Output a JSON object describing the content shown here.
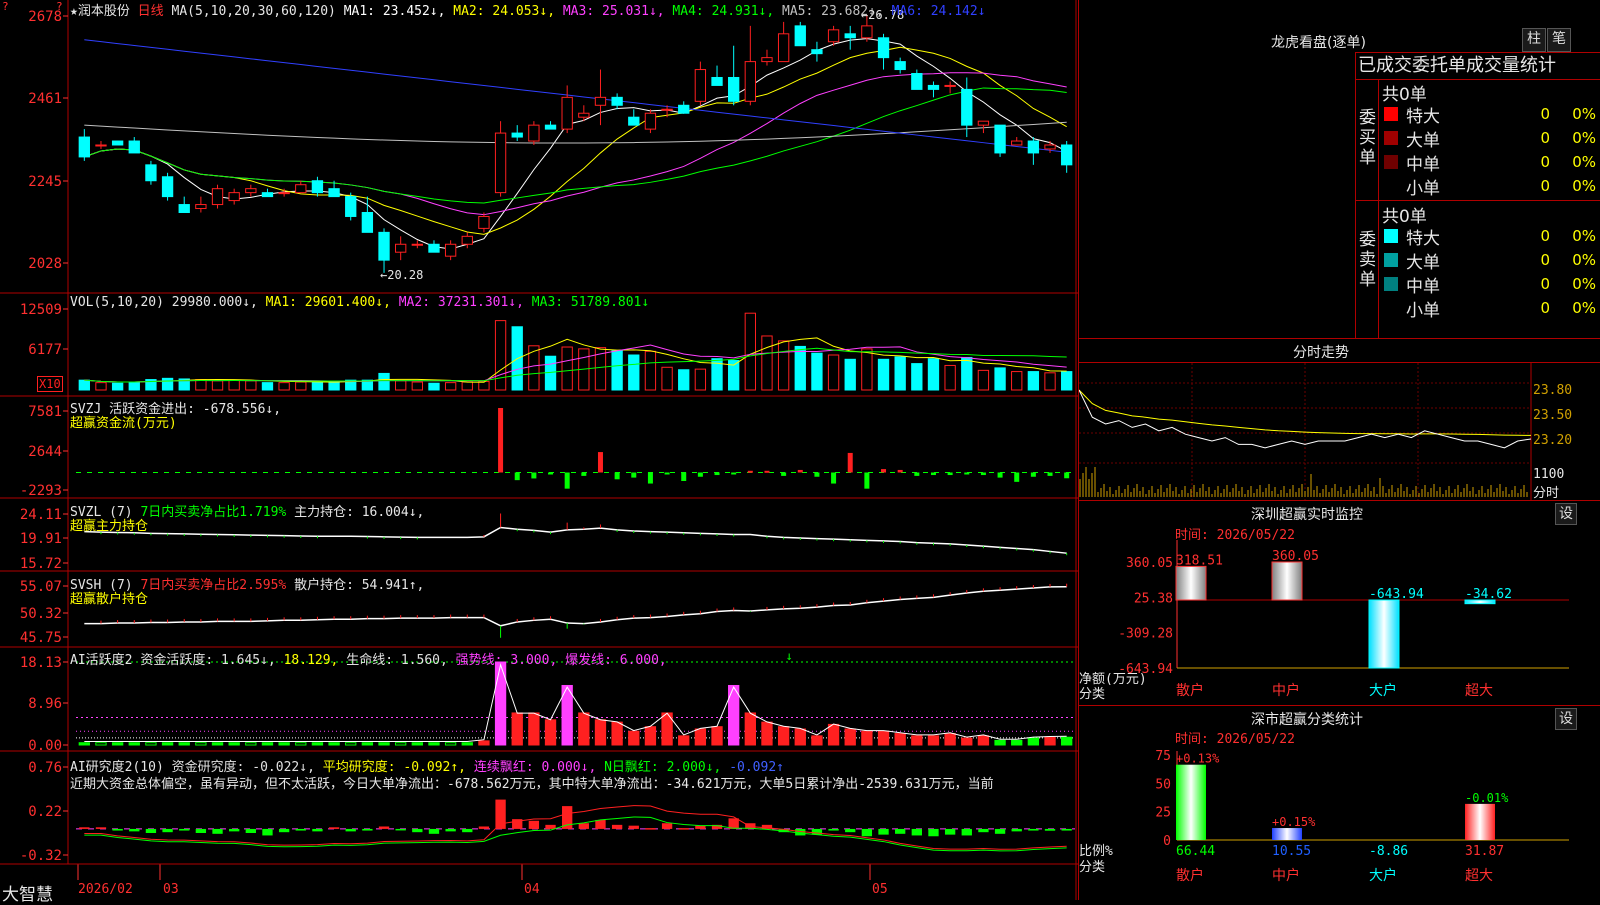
{
  "colors": {
    "up": "#ff2020",
    "down": "#00ffff",
    "accent": "#ffff00",
    "grid": "#8b0000"
  },
  "main": {
    "title_line": "★润本股份",
    "period": "日线",
    "ma_label": "MA(5,10,20,30,60,120)",
    "ma_values": [
      {
        "text": "MA1: 23.452↓,",
        "color": "#ffffff"
      },
      {
        "text": "MA2: 24.053↓,",
        "color": "#ffff00"
      },
      {
        "text": "MA3: 25.031↓,",
        "color": "#ff40ff"
      },
      {
        "text": "MA4: 24.931↓,",
        "color": "#00ff00"
      },
      {
        "text": "MA5: 23.682↓,",
        "color": "#c0c0c0"
      },
      {
        "text": "MA6: 24.142↓",
        "color": "#3040ff"
      }
    ],
    "y_ticks": [
      "2678",
      "2461",
      "2245",
      "2028"
    ],
    "high_label": "←26.78",
    "low_label": "←20.28"
  },
  "volume": {
    "label": "VOL(5,10,20)",
    "value": "29980.000↓,",
    "ma1": "MA1: 29601.400↓,",
    "ma2": "MA2: 37231.301↓,",
    "ma3": "MA3: 51789.801↓",
    "y_ticks": [
      "12509",
      "6177"
    ],
    "unit": "X10"
  },
  "svzj": {
    "label": "SVZJ",
    "desc": "活跃资金进出: -678.556↓,",
    "name": "超赢资金流(万元)",
    "y_ticks": [
      "7581",
      "2644",
      "-2293"
    ]
  },
  "svzl": {
    "label": "SVZL (7)",
    "desc1": "7日内买卖净占比1.719%",
    "desc2": "主力持仓: 16.004↓,",
    "name": "超赢主力持仓",
    "y_ticks": [
      "24.11",
      "19.91",
      "15.72"
    ]
  },
  "svsh": {
    "label": "SVSH (7)",
    "desc1": "7日内买卖净占比2.595%",
    "desc2": "散户持仓: 54.941↑,",
    "name": "超赢散户持仓",
    "y_ticks": [
      "55.07",
      "50.32",
      "45.75"
    ]
  },
  "ai1": {
    "label": "AI活跃度2",
    "items": [
      {
        "text": "资金活跃度: 1.645↓,",
        "color": "#e0e0e0"
      },
      {
        "text": "18.129,",
        "color": "#ffff00"
      },
      {
        "text": "生命线: 1.560,",
        "color": "#e0e0e0"
      },
      {
        "text": "强势线: 3.000,",
        "color": "#ff40ff"
      },
      {
        "text": "爆发线: 6.000,",
        "color": "#ff40ff"
      }
    ],
    "y_ticks": [
      "18.13",
      "8.96",
      "0.00"
    ]
  },
  "ai2": {
    "label": "AI研究度2(10)",
    "items": [
      {
        "text": "资金研究度: -0.022↓,",
        "color": "#e0e0e0"
      },
      {
        "text": "平均研究度: -0.092↑,",
        "color": "#ffff00"
      },
      {
        "text": "连续飘红: 0.000↓,",
        "color": "#ff40ff"
      },
      {
        "text": "N日飘红: 2.000↓,",
        "color": "#00ff00"
      },
      {
        "text": "-0.092↑",
        "color": "#4060ff"
      }
    ],
    "comment": "近期大资金总体偏空，虽有异动，但不太活跃，今日大单净流出：-678.562万元，其中特大单净流出：-34.621万元，大单5日累计净出-2539.631万元，当前",
    "y_ticks": [
      "0.76",
      "0.22",
      "-0.32"
    ]
  },
  "x_axis": {
    "labels": [
      "2026/02",
      "03",
      "04",
      "05"
    ],
    "brand": "大智慧"
  },
  "right": {
    "dragon_title": "龙虎看盘(逐单)",
    "btn_bar": "柱",
    "btn_pen": "笔",
    "tabs": "已成交委托单成交量统计",
    "buy_side": "委买单",
    "sell_side": "委卖单",
    "buy_total": "共0单",
    "sell_total": "共0单",
    "buy_rows": [
      {
        "name": "特大",
        "count": "0",
        "pct": "0%",
        "color": "#ff0000"
      },
      {
        "name": "大单",
        "count": "0",
        "pct": "0%",
        "color": "#a00000"
      },
      {
        "name": "中单",
        "count": "0",
        "pct": "0%",
        "color": "#700000"
      },
      {
        "name": "小单",
        "count": "0",
        "pct": "0%",
        "color": "#000000"
      }
    ],
    "sell_rows": [
      {
        "name": "特大",
        "count": "0",
        "pct": "0%",
        "color": "#00ffff"
      },
      {
        "name": "大单",
        "count": "0",
        "pct": "0%",
        "color": "#00a0a0"
      },
      {
        "name": "中单",
        "count": "0",
        "pct": "0%",
        "color": "#008080"
      },
      {
        "name": "小单",
        "count": "0",
        "pct": "0%",
        "color": "#000000"
      }
    ],
    "intraday_title": "分时走势",
    "intraday_ticks": [
      "23.80",
      "23.50",
      "23.20"
    ],
    "intraday_vol": "1100",
    "intraday_unit": "分时",
    "sz_monitor_title": "深圳超赢实时监控",
    "sz_monitor_time": "时间: 2026/05/22",
    "set_btn": "设",
    "monitor_ticks": [
      "360.05",
      "25.38",
      "-309.28",
      "-643.94"
    ],
    "monitor_unit1": "净额(万元)",
    "monitor_unit2": "分类",
    "monitor_bars": [
      {
        "cat": "散户",
        "value": 318.51,
        "label": "318.51"
      },
      {
        "cat": "中户",
        "value": 360.05,
        "label": "360.05"
      },
      {
        "cat": "大户",
        "value": -643.94,
        "label": "-643.94"
      },
      {
        "cat": "超大",
        "value": -34.62,
        "label": "-34.62"
      }
    ],
    "class_title": "深市超赢分类统计",
    "class_time": "时间: 2026/05/22",
    "class_ticks": [
      "75",
      "50",
      "25",
      "0"
    ],
    "class_unit1": "比例%",
    "class_unit2": "分类",
    "class_bars": [
      {
        "cat": "散户",
        "pct": 66.44,
        "pct_label": "66.44",
        "change": "+0.13%"
      },
      {
        "cat": "中户",
        "pct": 10.55,
        "pct_label": "10.55",
        "change": "+0.15%"
      },
      {
        "cat": "大户",
        "pct": -8.86,
        "pct_label": "-8.86",
        "change": ""
      },
      {
        "cat": "超大",
        "pct": 31.87,
        "pct_label": "31.87",
        "change": "-0.01%"
      }
    ]
  },
  "chart_data": [
    {
      "type": "candlestick",
      "title": "★润本股份 日线",
      "ylim": [
        20.28,
        26.78
      ],
      "ohlc": [
        [
          23.7,
          23.9,
          23.1,
          23.2
        ],
        [
          23.5,
          23.6,
          23.4,
          23.5
        ],
        [
          23.6,
          23.6,
          23.5,
          23.5
        ],
        [
          23.6,
          23.7,
          23.3,
          23.3
        ],
        [
          23.0,
          23.1,
          22.5,
          22.6
        ],
        [
          22.7,
          22.8,
          22.1,
          22.2
        ],
        [
          22.0,
          22.2,
          21.8,
          21.8
        ],
        [
          21.9,
          22.2,
          21.8,
          22.0
        ],
        [
          22.0,
          22.5,
          21.9,
          22.4
        ],
        [
          22.1,
          22.4,
          22.0,
          22.3
        ],
        [
          22.3,
          22.5,
          22.2,
          22.4
        ],
        [
          22.3,
          22.4,
          22.2,
          22.2
        ],
        [
          22.3,
          22.4,
          22.2,
          22.3
        ],
        [
          22.3,
          22.6,
          22.3,
          22.5
        ],
        [
          22.6,
          22.7,
          22.2,
          22.3
        ],
        [
          22.4,
          22.6,
          22.2,
          22.2
        ],
        [
          22.2,
          22.3,
          21.6,
          21.7
        ],
        [
          21.8,
          22.2,
          21.3,
          21.3
        ],
        [
          21.3,
          21.4,
          20.28,
          20.6
        ],
        [
          20.8,
          21.2,
          20.6,
          21.0
        ],
        [
          21.0,
          21.1,
          20.9,
          21.0
        ],
        [
          21.0,
          21.1,
          20.8,
          20.8
        ],
        [
          20.7,
          21.1,
          20.6,
          21.0
        ],
        [
          21.0,
          21.3,
          20.9,
          21.2
        ],
        [
          21.4,
          21.8,
          21.3,
          21.7
        ],
        [
          22.3,
          24.1,
          22.2,
          23.8
        ],
        [
          23.8,
          24.0,
          23.6,
          23.7
        ],
        [
          23.6,
          24.1,
          23.5,
          24.0
        ],
        [
          24.0,
          24.1,
          23.9,
          23.9
        ],
        [
          23.9,
          25.0,
          23.8,
          24.7
        ],
        [
          24.2,
          24.5,
          24.1,
          24.3
        ],
        [
          24.5,
          25.4,
          24.0,
          24.7
        ],
        [
          24.7,
          24.8,
          24.4,
          24.5
        ],
        [
          24.2,
          24.4,
          24.0,
          24.0
        ],
        [
          23.9,
          24.4,
          23.8,
          24.3
        ],
        [
          24.4,
          24.5,
          24.2,
          24.4
        ],
        [
          24.5,
          24.6,
          24.3,
          24.3
        ],
        [
          24.6,
          25.6,
          24.5,
          25.4
        ],
        [
          25.2,
          25.5,
          25.0,
          25.0
        ],
        [
          25.2,
          26.0,
          24.5,
          24.6
        ],
        [
          24.6,
          26.5,
          24.5,
          25.6
        ],
        [
          25.6,
          25.9,
          25.5,
          25.7
        ],
        [
          25.6,
          26.6,
          25.6,
          26.3
        ],
        [
          26.5,
          26.6,
          26.0,
          26.0
        ],
        [
          25.9,
          26.1,
          25.6,
          25.8
        ],
        [
          26.1,
          26.5,
          26.0,
          26.4
        ],
        [
          26.3,
          26.5,
          25.9,
          26.2
        ],
        [
          26.2,
          26.78,
          26.1,
          26.5
        ],
        [
          26.2,
          26.3,
          25.4,
          25.7
        ],
        [
          25.6,
          25.7,
          25.3,
          25.4
        ],
        [
          25.3,
          25.4,
          24.9,
          24.9
        ],
        [
          25.0,
          25.1,
          24.7,
          24.9
        ],
        [
          25.0,
          25.1,
          24.8,
          25.0
        ],
        [
          24.9,
          25.2,
          23.7,
          24.0
        ],
        [
          24.0,
          24.1,
          23.8,
          24.1
        ],
        [
          24.0,
          24.0,
          23.2,
          23.3
        ],
        [
          23.5,
          23.7,
          23.5,
          23.6
        ],
        [
          23.6,
          23.7,
          23.0,
          23.3
        ],
        [
          23.4,
          23.6,
          23.3,
          23.5
        ],
        [
          23.5,
          23.6,
          22.8,
          23.0
        ]
      ]
    },
    {
      "type": "bar",
      "title": "VOL(5,10,20)",
      "values": [
        1600,
        1200,
        1100,
        1300,
        1700,
        1900,
        1800,
        1700,
        1500,
        1600,
        1500,
        1200,
        1200,
        1300,
        1400,
        1300,
        1600,
        1600,
        2700,
        1500,
        1300,
        1100,
        1200,
        1300,
        1400,
        11300,
        10300,
        7200,
        5500,
        7000,
        6700,
        6900,
        6400,
        5700,
        6300,
        3700,
        3300,
        3400,
        5100,
        4800,
        12509,
        8800,
        8000,
        7100,
        6000,
        5700,
        5000,
        6700,
        5000,
        5400,
        4300,
        5100,
        4000,
        5300,
        3200,
        3600,
        3000,
        3000,
        2800,
        2998
      ]
    },
    {
      "type": "bar",
      "title": "SVZJ 活跃资金进出",
      "values": [
        0,
        0,
        0,
        0,
        0,
        0,
        0,
        0,
        0,
        0,
        0,
        0,
        0,
        0,
        0,
        0,
        0,
        0,
        0,
        0,
        0,
        0,
        0,
        0,
        0,
        7581,
        -900,
        -700,
        -100,
        -1900,
        -400,
        2400,
        -800,
        -600,
        -1300,
        -100,
        -1000,
        -500,
        -300,
        -200,
        200,
        200,
        -400,
        300,
        -500,
        -1300,
        2300,
        -1900,
        400,
        300,
        -400,
        -300,
        -300,
        -200,
        -300,
        -600,
        -1100,
        -500,
        -400,
        -678
      ]
    },
    {
      "type": "line",
      "title": "SVZL 主力持仓",
      "values": [
        21.1,
        21.0,
        20.95,
        20.9,
        20.8,
        20.75,
        20.7,
        20.65,
        20.6,
        20.55,
        20.5,
        20.45,
        20.4,
        20.35,
        20.3,
        20.3,
        20.3,
        20.25,
        20.2,
        20.15,
        20.1,
        20.1,
        20.1,
        20.1,
        20.2,
        21.8,
        21.5,
        21.3,
        21.0,
        21.4,
        21.5,
        21.7,
        21.4,
        21.2,
        21.1,
        21.0,
        20.9,
        20.8,
        20.7,
        20.6,
        20.6,
        20.3,
        20.1,
        20.0,
        19.9,
        19.8,
        19.7,
        19.6,
        19.5,
        19.4,
        19.2,
        19.1,
        19.0,
        18.8,
        18.6,
        18.4,
        18.2,
        18.0,
        17.7,
        17.4
      ]
    },
    {
      "type": "line",
      "title": "SVSH 散户持仓",
      "values": [
        48.2,
        48.2,
        48.3,
        48.3,
        48.4,
        48.4,
        48.5,
        48.5,
        48.6,
        48.6,
        48.6,
        48.7,
        48.8,
        48.8,
        48.9,
        49.0,
        49.0,
        49.1,
        49.1,
        49.2,
        49.2,
        49.2,
        49.3,
        49.3,
        49.3,
        47.8,
        48.5,
        48.8,
        49.0,
        48.3,
        48.2,
        48.5,
        48.9,
        49.2,
        49.3,
        49.5,
        49.8,
        50.0,
        50.4,
        50.6,
        50.5,
        50.7,
        50.9,
        51.0,
        51.2,
        51.5,
        51.6,
        52.0,
        52.3,
        52.6,
        52.8,
        53.0,
        53.4,
        53.8,
        54.1,
        54.3,
        54.5,
        54.7,
        54.9,
        54.941
      ]
    },
    {
      "type": "bar",
      "title": "AI活跃度2",
      "values": [
        0.5,
        0.5,
        0.5,
        0.5,
        0.5,
        0.5,
        0.5,
        0.5,
        0.5,
        0.5,
        0.5,
        0.5,
        0.5,
        0.5,
        0.5,
        0.5,
        0.5,
        0.5,
        0.5,
        0.5,
        0.5,
        0.5,
        0.5,
        0.5,
        0.9,
        18.13,
        7.0,
        7.0,
        5.5,
        13.0,
        7.0,
        5.5,
        5.0,
        3.0,
        4.0,
        7.0,
        2.0,
        3.5,
        4.0,
        13.0,
        7.0,
        5.0,
        4.0,
        3.5,
        2.0,
        4.5,
        3.5,
        3.0,
        3.0,
        2.5,
        2.0,
        2.0,
        2.5,
        1.5,
        2.0,
        1.0,
        1.0,
        1.5,
        1.645,
        1.7
      ]
    },
    {
      "type": "bar",
      "title": "AI研究度2(10)",
      "values": [
        0.02,
        0.02,
        -0.02,
        -0.03,
        -0.05,
        -0.04,
        -0.02,
        -0.05,
        -0.06,
        -0.03,
        -0.05,
        -0.08,
        -0.04,
        -0.02,
        -0.03,
        0.02,
        -0.03,
        -0.02,
        0.03,
        -0.01,
        -0.04,
        -0.06,
        -0.03,
        -0.04,
        0.03,
        0.36,
        0.12,
        0.1,
        0.05,
        0.28,
        0.07,
        0.11,
        0.05,
        0.04,
        0.01,
        0.07,
        0.01,
        0.04,
        0.05,
        0.13,
        0.07,
        0.05,
        -0.04,
        -0.08,
        -0.07,
        -0.02,
        -0.04,
        -0.09,
        -0.07,
        -0.06,
        -0.08,
        -0.09,
        -0.07,
        -0.08,
        -0.04,
        -0.06,
        -0.03,
        -0.02,
        -0.022,
        -0.02
      ]
    },
    {
      "type": "line",
      "title": "分时走势",
      "ylim": [
        22.7,
        23.95
      ],
      "values": [
        23.7,
        23.3,
        23.2,
        23.25,
        23.15,
        23.2,
        23.1,
        23.15,
        23.05,
        23.0,
        22.95,
        23.0,
        22.9,
        22.9,
        22.85,
        22.9,
        22.95,
        22.9,
        22.95,
        22.95,
        22.95,
        23.0,
        23.05,
        23.0,
        23.05,
        23.0,
        23.1,
        23.05,
        23.0,
        22.95,
        22.95,
        22.9,
        22.85,
        22.95,
        22.98
      ]
    },
    {
      "type": "bar",
      "title": "深圳超赢实时监控",
      "ylabel": "净额(万元)",
      "categories": [
        "散户",
        "中户",
        "大户",
        "超大"
      ],
      "values": [
        318.51,
        360.05,
        -643.94,
        -34.62
      ],
      "ylim": [
        -643.94,
        360.05
      ]
    },
    {
      "type": "bar",
      "title": "深市超赢分类统计",
      "ylabel": "比例%",
      "categories": [
        "散户",
        "中户",
        "大户",
        "超大"
      ],
      "values": [
        66.44,
        10.55,
        -8.86,
        31.87
      ],
      "ylim": [
        0,
        75
      ]
    }
  ]
}
